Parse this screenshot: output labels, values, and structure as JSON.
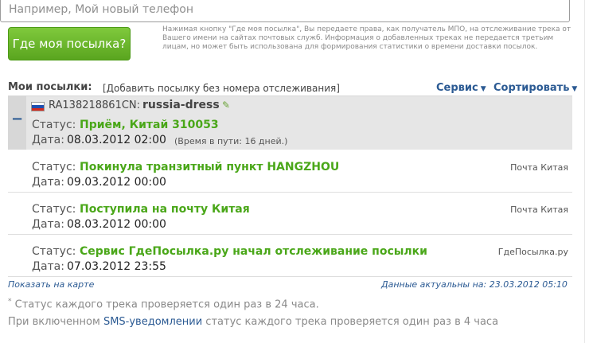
{
  "search": {
    "placeholder": "Например, Мой новый телефон"
  },
  "track_button": {
    "label": "Где моя посылка?"
  },
  "disclaimer": "Нажимая кнопку \"Где моя посылка\", Вы передаете права, как получатель МПО, на отслеживание трека от Вашего имени на сайтах почтовых служб. Информация о добавленных треках не передается третьим лицам, но может быть использована для формирования статистики о времени доставки посылок.",
  "section": {
    "title": "Мои посылки:",
    "add_link": "[Добавить посылку без номера отслеживания]",
    "service_menu": "Сервис",
    "sort_menu": "Сортировать"
  },
  "labels": {
    "status": "Статус:",
    "date": "Дата:"
  },
  "package": {
    "country_flag": "russia-flag",
    "flag_colors": [
      "#ffffff",
      "#1f4fb0",
      "#d52b1e"
    ],
    "tracking_number": "RA138218861CN:",
    "name": "russia-dress",
    "status": "Приём, Китай 310053",
    "date": "08.03.2012 02:00",
    "transit_time": "(Время в пути: 16 дней.)"
  },
  "history": [
    {
      "status": "Покинула транзитный пункт HANGZHOU",
      "date": "09.03.2012 00:00",
      "source": "Почта Китая"
    },
    {
      "status": "Поступила на почту Китая",
      "date": "08.03.2012 00:00",
      "source": "Почта Китая"
    },
    {
      "status": "Сервис ГдеПосылка.ру начал отслеживание посылки",
      "date": "07.03.2012 23:55",
      "source": "ГдеПосылка.ру"
    }
  ],
  "footer": {
    "map_link": "Показать на карте",
    "actual_data": "Данные актуальны на: 23.03.2012 05:10",
    "note_mark": "*",
    "note1": " Статус каждого трека проверяется один раз в 24 часа.",
    "note2_before": "При включенном ",
    "sms_link": "SMS-уведомлении",
    "note2_after": " статус каждого трека проверяется один раз в 4 часа"
  },
  "colors": {
    "status_green": "#4aa719",
    "link_blue": "#2b5a93",
    "button_green": "#6bb82c"
  }
}
